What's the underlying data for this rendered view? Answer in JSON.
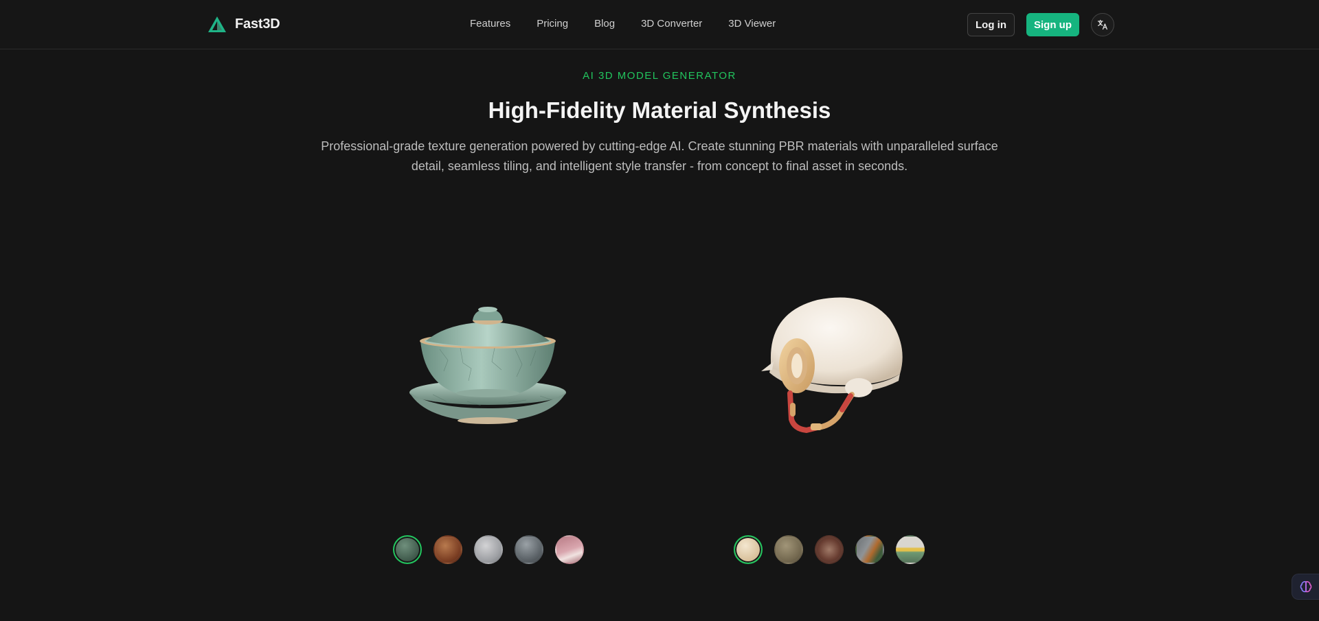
{
  "header": {
    "logo_text": "Fast3D",
    "nav": [
      "Features",
      "Pricing",
      "Blog",
      "3D Converter",
      "3D Viewer"
    ],
    "login_label": "Log in",
    "signup_label": "Sign up",
    "lang_icon": "translate-icon"
  },
  "hero": {
    "eyebrow": "AI 3D MODEL GENERATOR",
    "title": "High-Fidelity Material Synthesis",
    "subtitle": "Professional-grade texture generation powered by cutting-edge AI. Create stunning PBR materials with unparalleled surface detail, seamless tiling, and intelligent style transfer - from concept to final asset in seconds."
  },
  "showcase": {
    "left_model": "celadon-teacup",
    "right_model": "helmet",
    "left_swatches": [
      "crackle-celadon",
      "rust-copper",
      "brushed-silver",
      "slate-grey",
      "pink-marble"
    ],
    "right_swatches": [
      "cream-leather",
      "olive-fabric",
      "ornate-bronze",
      "painted-steel",
      "striped-enamel"
    ],
    "left_selected": 0,
    "right_selected": 0
  },
  "colors": {
    "accent": "#22c55e",
    "signup_bg": "#16b47f",
    "background": "#151515"
  }
}
